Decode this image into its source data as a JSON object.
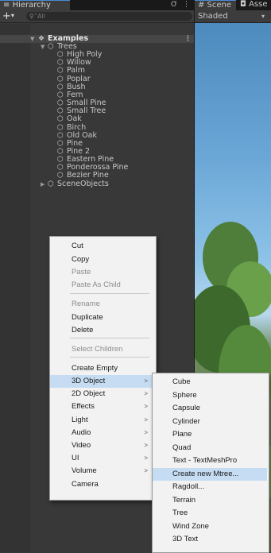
{
  "hierarchy": {
    "tab_title": "Hierarchy",
    "tab_icon": "list-icon",
    "lock_glyph": "Ơ",
    "more_glyph": "⋮",
    "add_label": "+",
    "add_arrow": "▾",
    "search_placeholder": "All",
    "search_icon": "search-icon",
    "scene": {
      "name": "Examples",
      "more": "⋮"
    },
    "trees_group": "Trees",
    "trees": [
      "High Poly",
      "Willow",
      "Palm",
      "Poplar",
      "Bush",
      "Fern",
      "Small Pine",
      "Small Tree",
      "Oak",
      "Birch",
      "Old Oak",
      "Pine",
      "Pine 2",
      "Eastern Pine",
      "Ponderossa Pine",
      "Bezier Pine"
    ],
    "other_group": "SceneObjects"
  },
  "scene": {
    "tabs": [
      {
        "label": "# Scene",
        "active": true
      },
      {
        "label": "◘ Asse",
        "active": false
      }
    ],
    "shading_mode": "Shaded",
    "dropdown_arrow": "▾"
  },
  "context_menu": {
    "items": [
      {
        "label": "Cut",
        "disabled": false
      },
      {
        "label": "Copy",
        "disabled": false
      },
      {
        "label": "Paste",
        "disabled": true
      },
      {
        "label": "Paste As Child",
        "disabled": true
      },
      {
        "label": "Rename",
        "disabled": true
      },
      {
        "label": "Duplicate",
        "disabled": false
      },
      {
        "label": "Delete",
        "disabled": false
      },
      {
        "label": "Select Children",
        "disabled": true
      },
      {
        "label": "Create Empty",
        "disabled": false
      },
      {
        "label": "3D Object",
        "disabled": false,
        "submenu": true,
        "highlighted": true
      },
      {
        "label": "2D Object",
        "disabled": false,
        "submenu": true
      },
      {
        "label": "Effects",
        "disabled": false,
        "submenu": true
      },
      {
        "label": "Light",
        "disabled": false,
        "submenu": true
      },
      {
        "label": "Audio",
        "disabled": false,
        "submenu": true
      },
      {
        "label": "Video",
        "disabled": false,
        "submenu": true
      },
      {
        "label": "UI",
        "disabled": false,
        "submenu": true
      },
      {
        "label": "Volume",
        "disabled": false,
        "submenu": true
      },
      {
        "label": "Camera",
        "disabled": false
      }
    ],
    "submenu_arrow": ">"
  },
  "submenu_3d": {
    "items": [
      {
        "label": "Cube"
      },
      {
        "label": "Sphere"
      },
      {
        "label": "Capsule"
      },
      {
        "label": "Cylinder"
      },
      {
        "label": "Plane"
      },
      {
        "label": "Quad"
      },
      {
        "label": "Text - TextMeshPro"
      },
      {
        "label": "Create new Mtree...",
        "highlighted": true
      },
      {
        "label": "Ragdoll..."
      },
      {
        "label": "Terrain"
      },
      {
        "label": "Tree"
      },
      {
        "label": "Wind Zone"
      },
      {
        "label": "3D Text"
      }
    ]
  },
  "colors": {
    "panel_bg": "#383838",
    "menu_bg": "#f2f2f2",
    "menu_highlight": "#c6dcf3",
    "tab_accent": "#4a8ad8"
  }
}
